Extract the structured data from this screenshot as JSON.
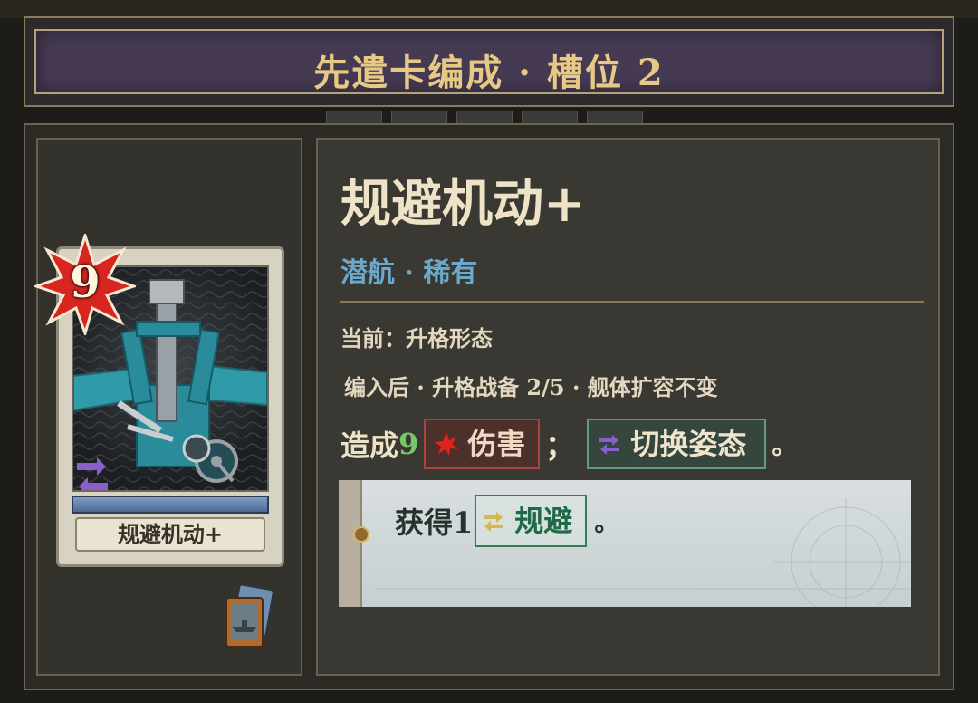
{
  "header": {
    "title": "先遣卡编成 · 槽位 2"
  },
  "card": {
    "cost": "9",
    "name_plate": "规避机动+"
  },
  "detail": {
    "title": "规避机动+",
    "subtitle": "潜航 · 稀有",
    "current_form": "当前：升格形态",
    "info": "编入后 · 升格战备 2/5 · 舰体扩容不变",
    "effect": {
      "prefix": "造成",
      "damage_value": "9",
      "damage_keyword": "伤害",
      "separator": "；",
      "stance_keyword": "切换姿态",
      "end": "。"
    },
    "bonus": {
      "prefix": "获得1",
      "keyword": "规避",
      "end": "。"
    }
  },
  "colors": {
    "title_gold": "#e6c987",
    "subtitle_blue": "#6aa9c9",
    "number_green": "#7ac66a",
    "damage_red": "#a9433f",
    "stance_teal": "#5e9c86",
    "evade_green": "#2d7f5a"
  },
  "icons": {
    "cost_badge": "red-star-burst",
    "stance": "purple-swap-arrows",
    "damage": "red-burst",
    "evade": "yellow-swap-arrows",
    "deck": "ship-card-deck"
  }
}
